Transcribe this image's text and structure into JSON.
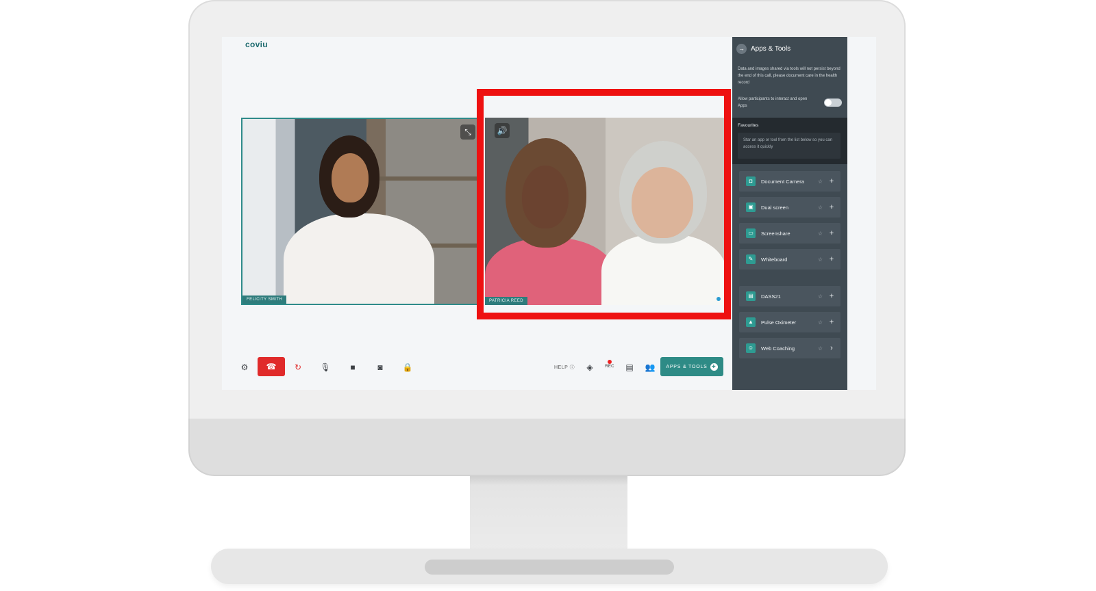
{
  "app": {
    "logo": "coviu"
  },
  "participants": {
    "left": {
      "name": "FELICITY SMITH"
    },
    "right": {
      "name": "PATRICIA REED"
    }
  },
  "toolbar": {
    "help_label": "HELP",
    "rec_label": "REC",
    "apps_tools_label": "APPS & TOOLS"
  },
  "panel": {
    "title": "Apps & Tools",
    "note": "Data and images shared via tools will not persist beyond the end of this call, please document care in the health record",
    "allow_label": "Allow participants to interact and open Apps",
    "allow_enabled": false,
    "favourites_title": "Favourites",
    "favourites_hint": "Star an app or tool from the list below so you can access it quickly",
    "tools": [
      {
        "label": "Document Camera",
        "icon": "camera-icon",
        "action": "+"
      },
      {
        "label": "Dual screen",
        "icon": "dual-screen-icon",
        "action": "+"
      },
      {
        "label": "Screenshare",
        "icon": "screenshare-icon",
        "action": "+"
      },
      {
        "label": "Whiteboard",
        "icon": "pencil-icon",
        "action": "+"
      },
      {
        "label": "DASS21",
        "icon": "form-icon",
        "action": "+"
      },
      {
        "label": "Pulse Oximeter",
        "icon": "oximeter-icon",
        "action": "+"
      },
      {
        "label": "Web Coaching",
        "icon": "people-icon",
        "action": "›"
      }
    ]
  },
  "colors": {
    "accent": "#2e8b86",
    "end_call": "#e02a2a",
    "highlight": "#ee1111",
    "panel_bg": "#3f4a52"
  }
}
